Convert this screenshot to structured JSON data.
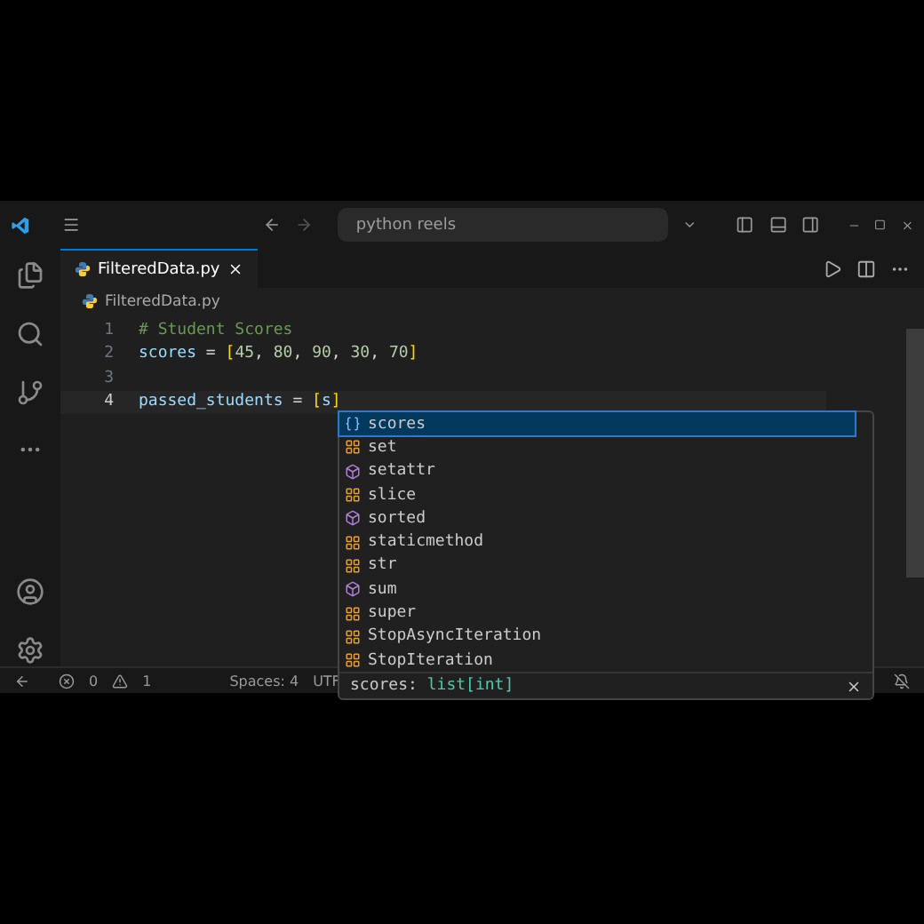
{
  "title_bar": {
    "search": "python reels"
  },
  "tabs": [
    {
      "label": "FilteredData.py",
      "selected": true
    }
  ],
  "breadcrumb": "FilteredData.py",
  "code_lines": [
    {
      "number": "1",
      "tokens": [
        {
          "text": "# Student Scores",
          "kind": "comment"
        }
      ]
    },
    {
      "number": "2",
      "tokens": [
        {
          "text": "scores",
          "kind": "variable"
        },
        {
          "text": " = ",
          "kind": "operator"
        },
        {
          "text": "[",
          "kind": "bracket"
        },
        {
          "text": "45",
          "kind": "number"
        },
        {
          "text": ", ",
          "kind": "operator"
        },
        {
          "text": "80",
          "kind": "number"
        },
        {
          "text": ", ",
          "kind": "operator"
        },
        {
          "text": "90",
          "kind": "number"
        },
        {
          "text": ", ",
          "kind": "operator"
        },
        {
          "text": "30",
          "kind": "number"
        },
        {
          "text": ", ",
          "kind": "operator"
        },
        {
          "text": "70",
          "kind": "number"
        },
        {
          "text": "]",
          "kind": "bracket"
        }
      ]
    },
    {
      "number": "3"
    },
    {
      "number": "4",
      "current": true,
      "tokens": [
        {
          "text": "passed_students",
          "kind": "variable"
        },
        {
          "text": " = ",
          "kind": "operator"
        },
        {
          "text": "[",
          "kind": "bracket"
        },
        {
          "text": "s",
          "kind": "variable"
        },
        {
          "text": "]",
          "kind": "bracket"
        }
      ]
    }
  ],
  "suggestions": [
    {
      "label": "scores",
      "kind": "variable",
      "selected": true
    },
    {
      "label": "set",
      "kind": "class",
      "selected": false
    },
    {
      "label": "setattr",
      "kind": "function",
      "selected": false
    },
    {
      "label": "slice",
      "kind": "class",
      "selected": false
    },
    {
      "label": "sorted",
      "kind": "function",
      "selected": false
    },
    {
      "label": "staticmethod",
      "kind": "class",
      "selected": false
    },
    {
      "label": "str",
      "kind": "class",
      "selected": false
    },
    {
      "label": "sum",
      "kind": "function",
      "selected": false
    },
    {
      "label": "super",
      "kind": "class",
      "selected": false
    },
    {
      "label": "StopAsyncIteration",
      "kind": "class",
      "selected": false
    },
    {
      "label": "StopIteration",
      "kind": "class",
      "selected": false
    }
  ],
  "suggestion_detail": {
    "name": "scores: ",
    "type": "list[int]"
  },
  "status_bar": {
    "errors": "0",
    "warnings": "1",
    "indent": "Spaces: 4",
    "encoding": "UTF"
  }
}
